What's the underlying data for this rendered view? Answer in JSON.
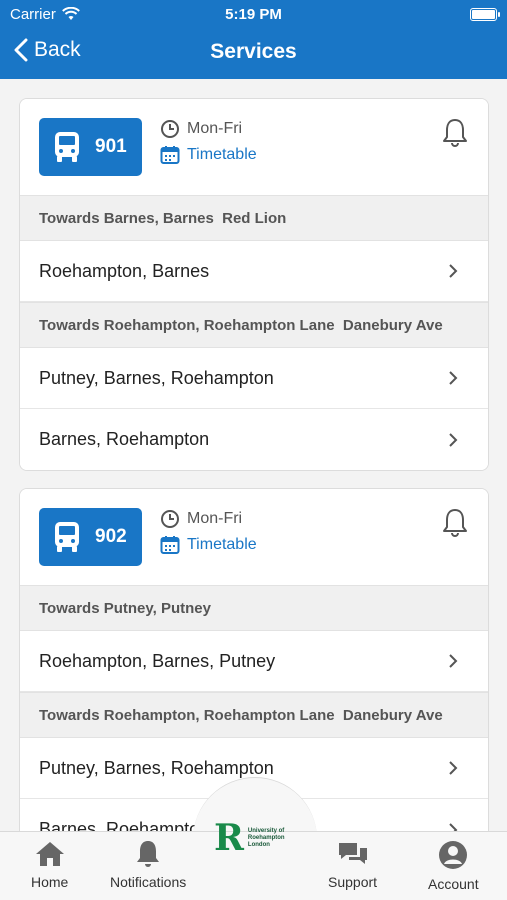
{
  "status": {
    "carrier": "Carrier",
    "time": "5:19 PM"
  },
  "nav": {
    "back_label": "Back",
    "title": "Services"
  },
  "services": [
    {
      "route": "901",
      "days": "Mon-Fri",
      "timetable_label": "Timetable",
      "directions": [
        {
          "heading": "Towards Barnes, Barnes  Red Lion",
          "routes": [
            "Roehampton, Barnes"
          ]
        },
        {
          "heading": "Towards Roehampton, Roehampton Lane  Danebury Ave",
          "routes": [
            "Putney, Barnes, Roehampton",
            "Barnes, Roehampton"
          ]
        }
      ]
    },
    {
      "route": "902",
      "days": "Mon-Fri",
      "timetable_label": "Timetable",
      "directions": [
        {
          "heading": "Towards Putney, Putney",
          "routes": [
            "Roehampton, Barnes, Putney"
          ]
        },
        {
          "heading": "Towards Roehampton, Roehampton Lane  Danebury Ave",
          "routes": [
            "Putney, Barnes, Roehampton",
            "Barnes, Roehampton"
          ]
        }
      ]
    }
  ],
  "tabs": {
    "home": "Home",
    "notifications": "Notifications",
    "support": "Support",
    "account": "Account"
  },
  "logo": {
    "line1": "University of",
    "line2": "Roehampton",
    "line3": "London"
  },
  "colors": {
    "brand": "#1976c6",
    "logo_green": "#1a8a4a"
  }
}
